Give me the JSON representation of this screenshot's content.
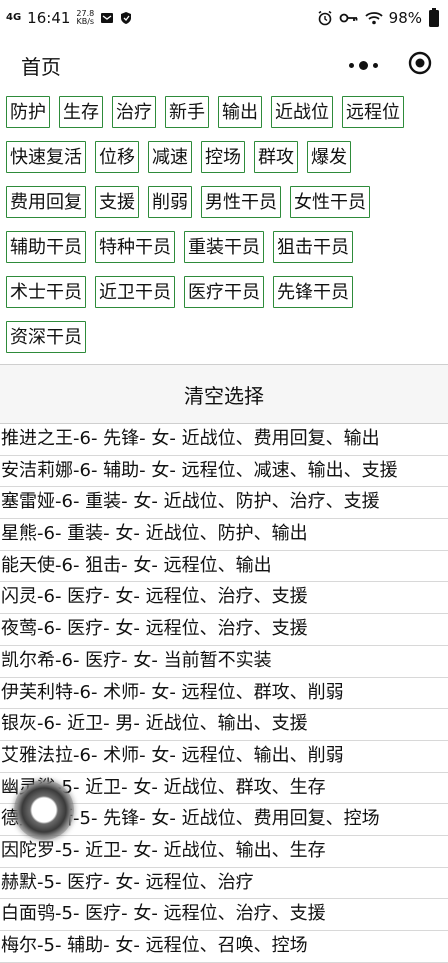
{
  "statusbar": {
    "signal": "4G",
    "time": "16:41",
    "speed_value": "27.8",
    "speed_unit": "KB/s",
    "battery": "98%"
  },
  "header": {
    "title": "首页",
    "more_icon": "more-dots-icon",
    "close_icon": "target-circle-icon"
  },
  "tags": [
    "防护",
    "生存",
    "治疗",
    "新手",
    "输出",
    "近战位",
    "远程位",
    "快速复活",
    "位移",
    "减速",
    "控场",
    "群攻",
    "爆发",
    "费用回复",
    "支援",
    "削弱",
    "男性干员",
    "女性干员",
    "辅助干员",
    "特种干员",
    "重装干员",
    "狙击干员",
    "术士干员",
    "近卫干员",
    "医疗干员",
    "先锋干员",
    "资深干员"
  ],
  "clear_button": "清空选择",
  "results": [
    "推进之王-6- 先锋- 女- 近战位、费用回复、输出",
    "安洁莉娜-6- 辅助- 女- 远程位、减速、输出、支援",
    "塞雷娅-6- 重装- 女- 近战位、防护、治疗、支援",
    "星熊-6- 重装- 女- 近战位、防护、输出",
    "能天使-6- 狙击- 女- 远程位、输出",
    "闪灵-6- 医疗- 女- 远程位、治疗、支援",
    "夜莺-6- 医疗- 女- 远程位、治疗、支援",
    "凯尔希-6- 医疗- 女- 当前暂不实装",
    "伊芙利特-6- 术师- 女- 远程位、群攻、削弱",
    "银灰-6- 近卫- 男- 近战位、输出、支援",
    "艾雅法拉-6- 术师- 女- 远程位、输出、削弱",
    "幽灵鲨-5- 近卫- 女- 近战位、群攻、生存",
    "德克萨斯-5- 先锋- 女- 近战位、费用回复、控场",
    "因陀罗-5- 近卫- 女- 近战位、输出、生存",
    "赫默-5- 医疗- 女- 远程位、治疗",
    "白面鸮-5- 医疗- 女- 远程位、治疗、支援",
    "梅尔-5- 辅助- 女- 远程位、召唤、控场"
  ]
}
